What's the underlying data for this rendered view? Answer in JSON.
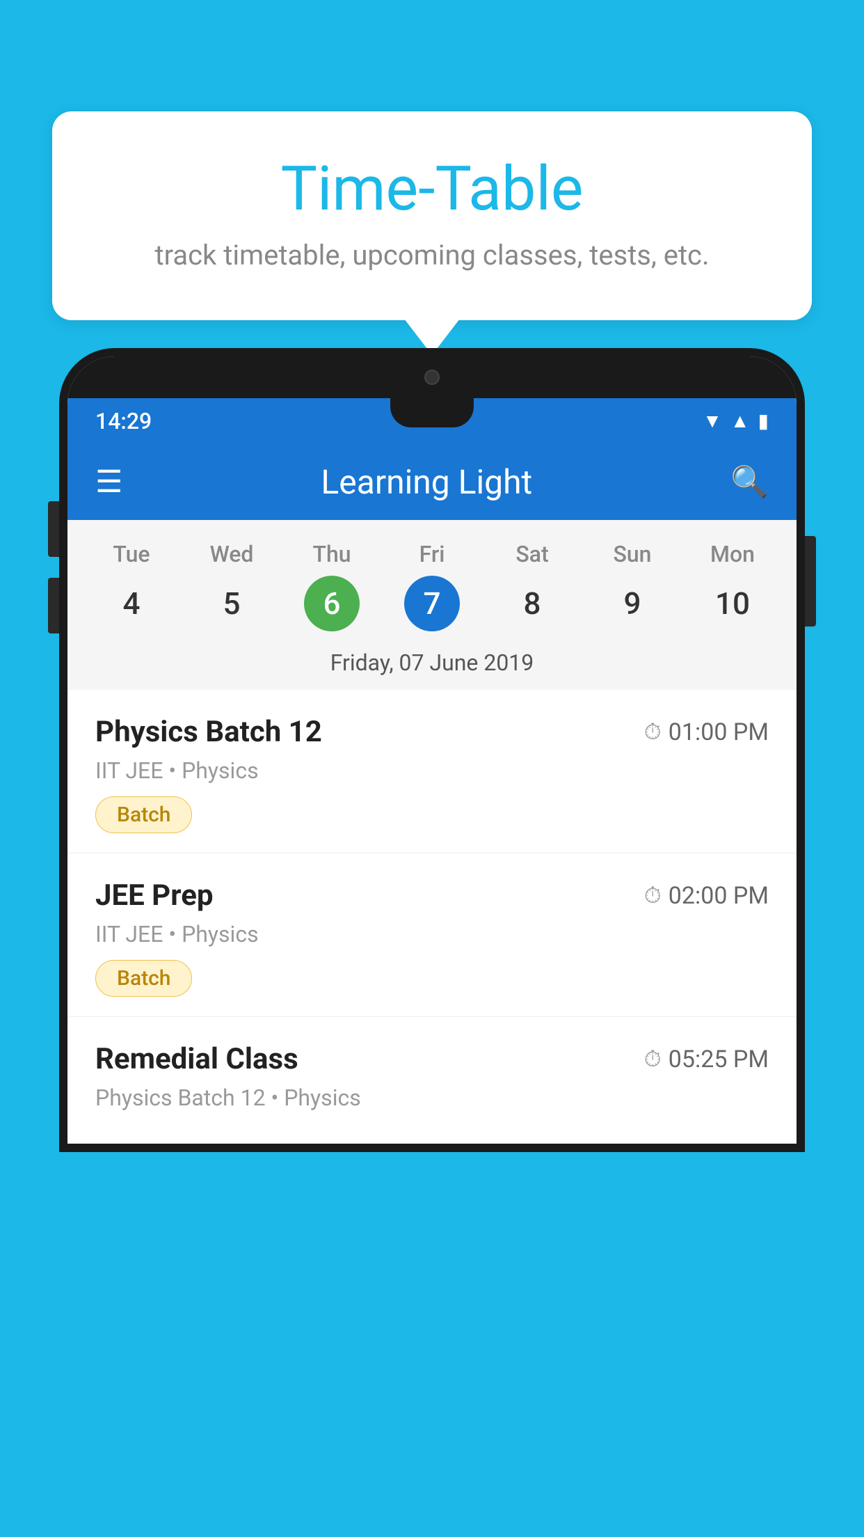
{
  "background": {
    "color": "#1BB8E8"
  },
  "bubble": {
    "title": "Time-Table",
    "subtitle": "track timetable, upcoming classes, tests, etc."
  },
  "phone": {
    "status_bar": {
      "time": "14:29"
    },
    "app_bar": {
      "title": "Learning Light"
    },
    "calendar": {
      "days": [
        {
          "name": "Tue",
          "number": "4",
          "state": "normal"
        },
        {
          "name": "Wed",
          "number": "5",
          "state": "normal"
        },
        {
          "name": "Thu",
          "number": "6",
          "state": "today"
        },
        {
          "name": "Fri",
          "number": "7",
          "state": "selected"
        },
        {
          "name": "Sat",
          "number": "8",
          "state": "normal"
        },
        {
          "name": "Sun",
          "number": "9",
          "state": "normal"
        },
        {
          "name": "Mon",
          "number": "10",
          "state": "normal"
        }
      ],
      "selected_date_label": "Friday, 07 June 2019"
    },
    "events": [
      {
        "title": "Physics Batch 12",
        "time": "01:00 PM",
        "subtitle": "IIT JEE • Physics",
        "badge": "Batch"
      },
      {
        "title": "JEE Prep",
        "time": "02:00 PM",
        "subtitle": "IIT JEE • Physics",
        "badge": "Batch"
      },
      {
        "title": "Remedial Class",
        "time": "05:25 PM",
        "subtitle": "Physics Batch 12 • Physics",
        "badge": ""
      }
    ]
  }
}
